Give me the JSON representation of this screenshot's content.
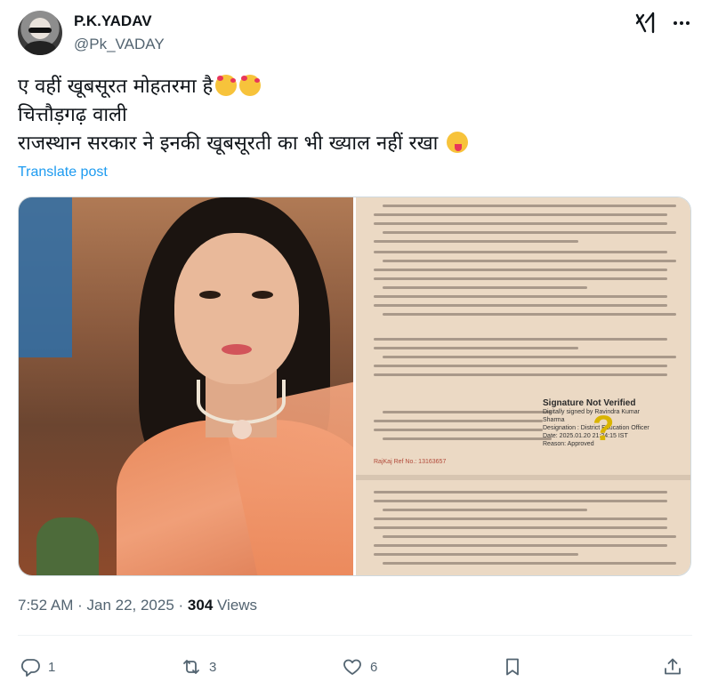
{
  "user": {
    "name": "P.K.YADAV",
    "handle": "@Pk_VADAY"
  },
  "tweet": {
    "lines": [
      "ए वहीं खूबसूरत मोहतरमा है",
      "चित्तौड़गढ़ वाली",
      "राजस्थान सरकार ने इनकी खूबसूरती का भी ख्याल नहीं रखा"
    ],
    "translate_label": "Translate post"
  },
  "document": {
    "signature_title": "Signature Not Verified",
    "signature_lines": [
      "Digitally signed by Ravindra Kumar",
      "Sharma",
      "Designation : District Education Officer",
      "Date: 2025.01.20 21:24:15 IST",
      "Reason: Approved"
    ],
    "footer_ref": "RajKaj Ref No.: 13163657"
  },
  "meta": {
    "time": "7:52 AM",
    "separator1": " · ",
    "date": "Jan 22, 2025",
    "separator2": " · ",
    "views_count": "304",
    "views_label": " Views"
  },
  "actions": {
    "replies": "1",
    "reposts": "3",
    "likes": "6"
  },
  "icons": {
    "grok": "grok-icon",
    "more": "more-icon",
    "reply": "reply-icon",
    "repost": "repost-icon",
    "like": "heart-icon",
    "bookmark": "bookmark-icon",
    "share": "share-icon"
  },
  "colors": {
    "link": "#1d9bf0",
    "secondary_text": "#536471",
    "primary_text": "#0f1419"
  }
}
